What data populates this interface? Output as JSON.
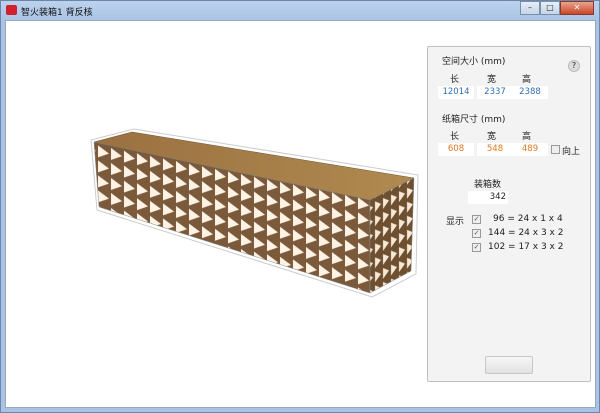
{
  "window": {
    "title": "智火装箱1 背反核",
    "minimize": "–",
    "maximize": "□",
    "close": "✕"
  },
  "space": {
    "title": "空间大小 (mm)",
    "help": "?",
    "headers": [
      "长",
      "宽",
      "高"
    ],
    "values": [
      "12014",
      "2337",
      "2388"
    ]
  },
  "carton": {
    "title": "纸箱尺寸 (mm)",
    "headers": [
      "长",
      "宽",
      "高"
    ],
    "values": [
      "608",
      "548",
      "489"
    ],
    "upright_label": "向上"
  },
  "count": {
    "label": "装箱数",
    "value": "342"
  },
  "display": {
    "label": "显示",
    "items": [
      {
        "text": "96 = 24 x 1 x 4",
        "checked": true
      },
      {
        "text": "144 = 24 x 3 x 2",
        "checked": true
      },
      {
        "text": "102 = 17 x 3 x 2",
        "checked": true
      }
    ]
  },
  "colors": {
    "box_brown": "#7a5a3a",
    "box_light": "#fff3e6",
    "top": "#a07a40"
  }
}
